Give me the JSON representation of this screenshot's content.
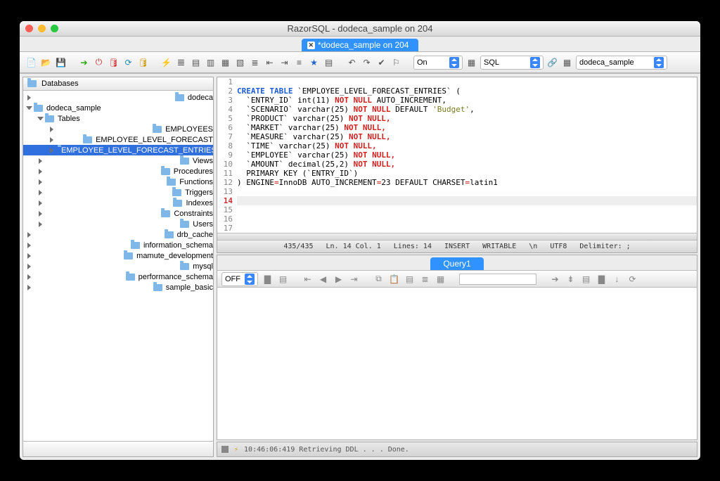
{
  "window": {
    "title": "RazorSQL - dodeca_sample on 204"
  },
  "tab": {
    "label": "*dodeca_sample on 204",
    "dirty": true
  },
  "toolbar": {
    "combo_on": "On",
    "combo_lang": "SQL",
    "combo_db": "dodeca_sample"
  },
  "sidebar": {
    "title": "Databases",
    "roots": [
      {
        "label": "dodeca",
        "expanded": false
      },
      {
        "label": "dodeca_sample",
        "expanded": true,
        "children": [
          {
            "label": "Tables",
            "expanded": true,
            "children": [
              {
                "label": "EMPLOYEES"
              },
              {
                "label": "EMPLOYEE_LEVEL_FORECAST"
              },
              {
                "label": "EMPLOYEE_LEVEL_FORECAST_ENTRIES",
                "selected": true
              }
            ]
          },
          {
            "label": "Views"
          },
          {
            "label": "Procedures"
          },
          {
            "label": "Functions"
          },
          {
            "label": "Triggers"
          },
          {
            "label": "Indexes"
          },
          {
            "label": "Constraints"
          },
          {
            "label": "Users"
          }
        ]
      },
      {
        "label": "drb_cache"
      },
      {
        "label": "information_schema"
      },
      {
        "label": "mamute_development"
      },
      {
        "label": "mysql"
      },
      {
        "label": "performance_schema"
      },
      {
        "label": "sample_basic"
      }
    ]
  },
  "editor": {
    "lines": [
      {
        "n": 1,
        "raw": ""
      },
      {
        "n": 2,
        "kw": "CREATE TABLE",
        "rest": " `EMPLOYEE_LEVEL_FORECAST_ENTRIES` ("
      },
      {
        "n": 3,
        "pre": "  `ENTRY_ID` int(11) ",
        "nn": "NOT NULL",
        "post": " AUTO_INCREMENT,"
      },
      {
        "n": 4,
        "pre": "  `SCENARIO` varchar(25) ",
        "nn": "NOT NULL",
        "post": " DEFAULT ",
        "str": "'Budget'",
        "tail": ","
      },
      {
        "n": 5,
        "pre": "  `PRODUCT` varchar(25) ",
        "nn": "NOT NULL,",
        "post": ""
      },
      {
        "n": 6,
        "pre": "  `MARKET` varchar(25) ",
        "nn": "NOT NULL,",
        "post": ""
      },
      {
        "n": 7,
        "pre": "  `MEASURE` varchar(25) ",
        "nn": "NOT NULL,",
        "post": ""
      },
      {
        "n": 8,
        "pre": "  `TIME` varchar(25) ",
        "nn": "NOT NULL,",
        "post": ""
      },
      {
        "n": 9,
        "pre": "  `EMPLOYEE` varchar(25) ",
        "nn": "NOT NULL,",
        "post": ""
      },
      {
        "n": 10,
        "pre": "  `AMOUNT` decimal(25,2) ",
        "nn": "NOT NULL,",
        "post": ""
      },
      {
        "n": 11,
        "raw": "  PRIMARY KEY (`ENTRY_ID`)"
      },
      {
        "n": 12,
        "raw_eng": ") ENGINE",
        "eq": "=",
        "mid": "InnoDB AUTO_INCREMENT",
        "eq2": "=",
        "mid2": "23 DEFAULT CHARSET",
        "eq3": "=",
        "end": "latin1"
      },
      {
        "n": 13,
        "raw": ""
      },
      {
        "n": 14,
        "raw": "",
        "current": true
      },
      {
        "n": 15,
        "raw": ""
      },
      {
        "n": 16,
        "raw": ""
      },
      {
        "n": 17,
        "raw": ""
      }
    ]
  },
  "status": {
    "bytes": "435/435",
    "pos": "Ln. 14 Col. 1",
    "lines": "Lines: 14",
    "mode": "INSERT",
    "rw": "WRITABLE",
    "eol": "\\n",
    "enc": "UTF8",
    "delim": "Delimiter: ;"
  },
  "results": {
    "tab_label": "Query1",
    "off_label": "OFF"
  },
  "log": {
    "text": "10:46:06:419 Retrieving DDL . . . Done."
  }
}
